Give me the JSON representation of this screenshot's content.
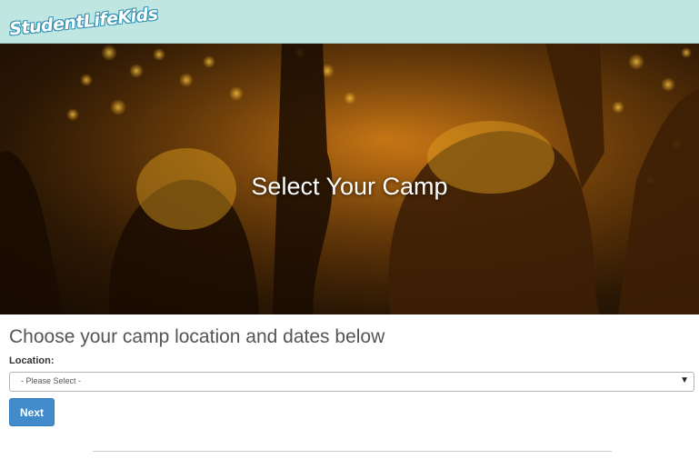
{
  "header": {
    "logo_text": "StudentLifeKids",
    "background": "#bfe6e0"
  },
  "hero": {
    "title": "Select Your Camp"
  },
  "main": {
    "heading": "Choose your camp location and dates below",
    "location_label": "Location:",
    "location_select": {
      "selected": "- Please Select -"
    },
    "next_label": "Next",
    "accent": "#428bca"
  }
}
